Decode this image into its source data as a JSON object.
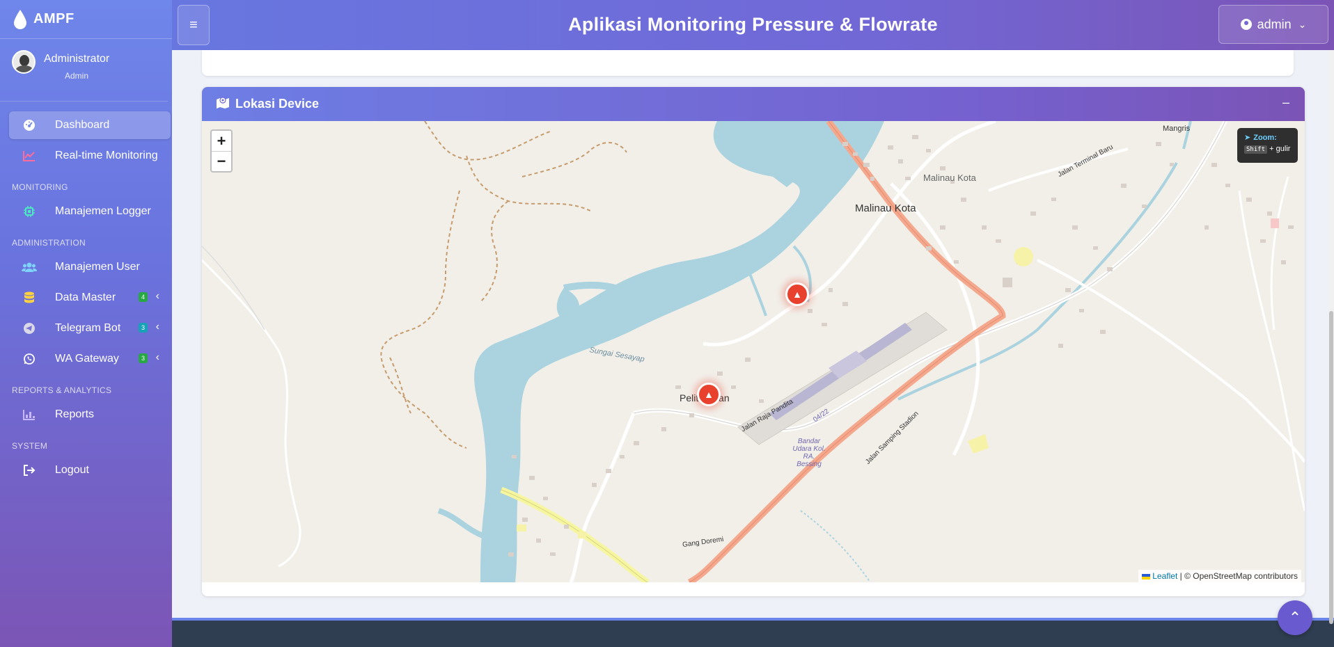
{
  "brand": {
    "name": "AMPF"
  },
  "user": {
    "name": "Administrator",
    "role": "Admin"
  },
  "nav": {
    "dashboard": "Dashboard",
    "realtime": "Real-time Monitoring",
    "section_monitoring": "MONITORING",
    "logger": "Manajemen Logger",
    "section_admin": "ADMINISTRATION",
    "users": "Manajemen User",
    "data_master": "Data Master",
    "data_master_badge": "4",
    "telegram": "Telegram Bot",
    "telegram_badge": "3",
    "wa": "WA Gateway",
    "wa_badge": "3",
    "section_reports": "REPORTS & ANALYTICS",
    "reports": "Reports",
    "section_system": "SYSTEM",
    "logout": "Logout"
  },
  "header": {
    "title": "Aplikasi Monitoring Pressure & Flowrate",
    "account": "admin"
  },
  "card": {
    "title": "Lokasi Device",
    "collapse": "–"
  },
  "map": {
    "zoom_in": "+",
    "zoom_out": "−",
    "hint_title": "Zoom:",
    "hint_key": "Shift",
    "hint_rest": "+ gulir",
    "attribution_link": "Leaflet",
    "attribution_rest": "| © OpenStreetMap contributors",
    "places": {
      "malinau_kota": "Malinau Kota",
      "malinau_kota_2": "Malinau Kota",
      "pelita_baan": "Pelita Baan",
      "sungai": "Sungai Sesayap",
      "airport": "Bandar Udara Kol. RA. Bessing",
      "runway": "04/22",
      "jalan_raja_pandita": "Jalan Raja Pandita",
      "jalan_samping_stadion": "Jalan Samping Stadion",
      "jalan_terminal_baru": "Jalan Terminal Baru",
      "gang_doremi": "Gang Doremi",
      "mangris": "Mangris"
    }
  }
}
